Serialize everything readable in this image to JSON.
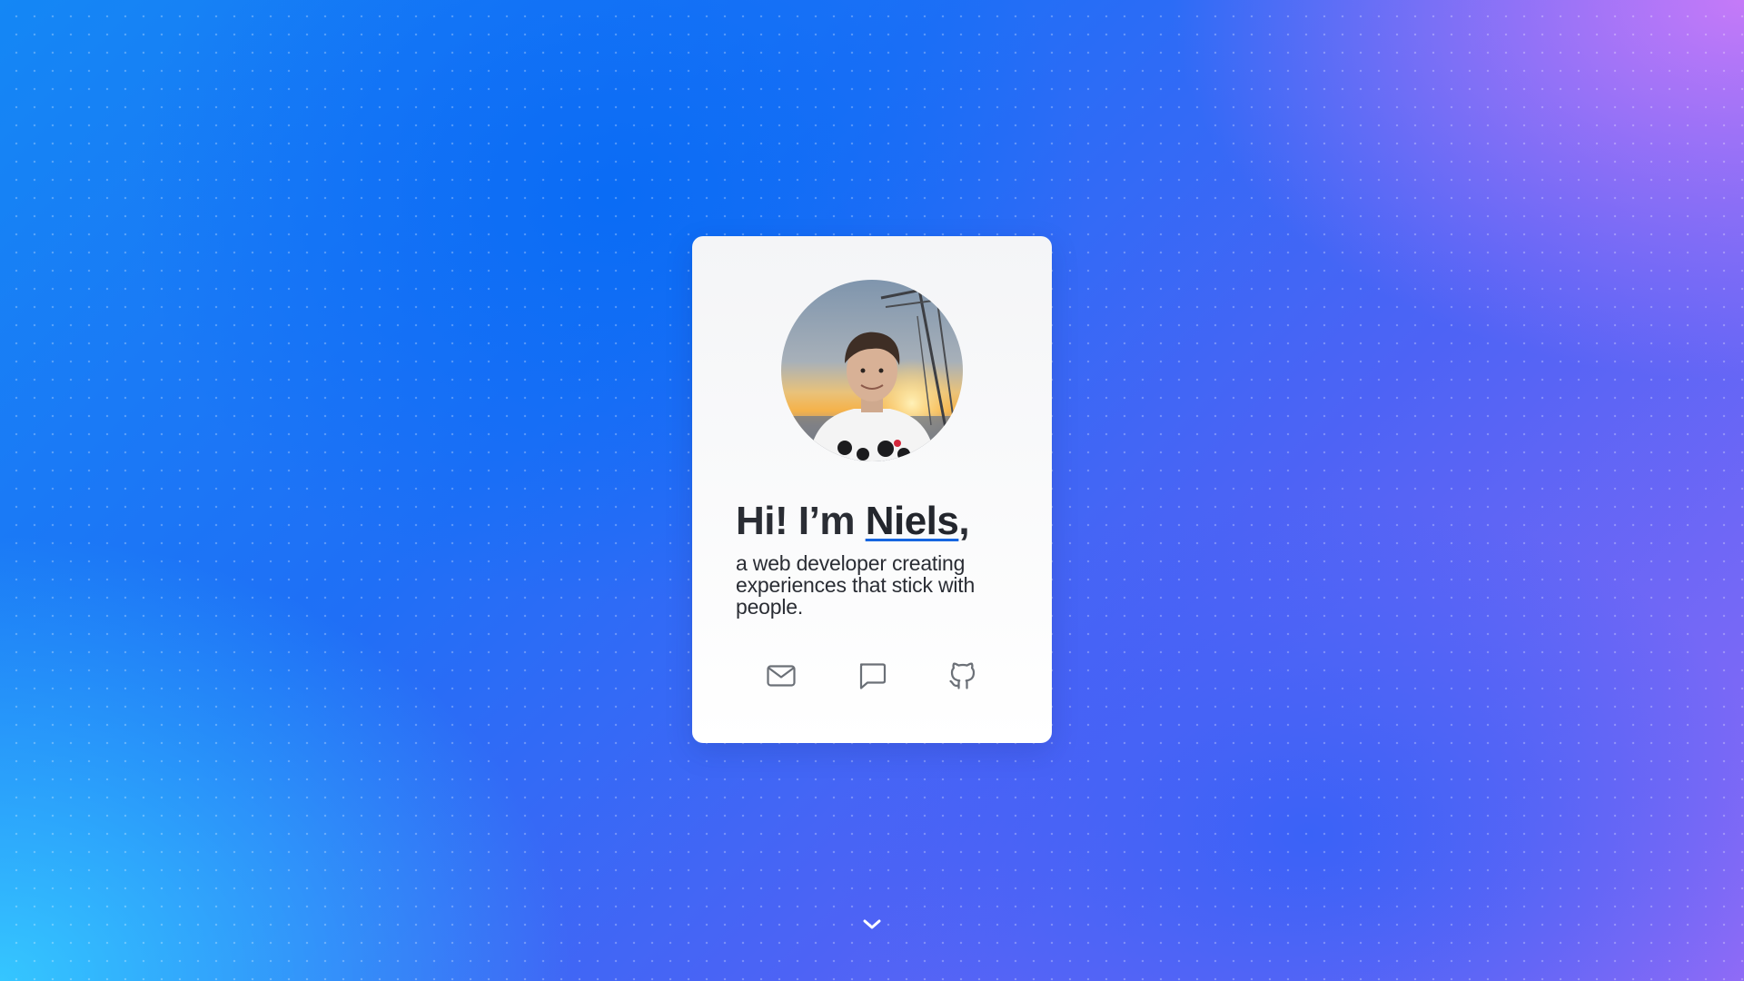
{
  "hero": {
    "greeting": "Hi! I’m ",
    "name": "Niels",
    "comma": ",",
    "subtitle": "a web developer creating experiences that stick with people."
  },
  "profile": {
    "avatar_alt": "Portrait photo of Niels at sunset on a sailboat"
  },
  "contact_links": [
    {
      "icon": "mail-icon",
      "label": "Email"
    },
    {
      "icon": "chat-icon",
      "label": "Message"
    },
    {
      "icon": "github-icon",
      "label": "GitHub"
    }
  ],
  "scroll": {
    "icon": "chevron-down-icon"
  },
  "colors": {
    "accent": "#1565e0",
    "text": "#2a2d34",
    "icon": "#6b7077"
  }
}
